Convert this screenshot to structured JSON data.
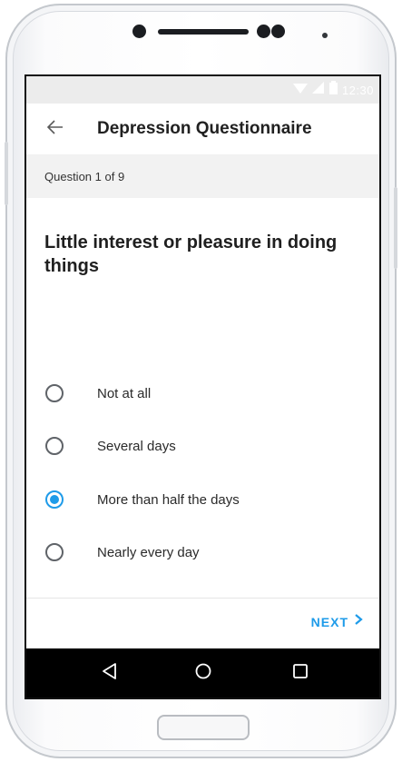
{
  "status_bar": {
    "time": "12:30"
  },
  "app_bar": {
    "title": "Depression Questionnaire",
    "back_icon": "arrow-left-icon"
  },
  "progress": {
    "text": "Question 1 of 9"
  },
  "question": {
    "text": "Little interest or pleasure in doing things"
  },
  "options": [
    {
      "label": "Not at all",
      "selected": false
    },
    {
      "label": "Several days",
      "selected": false
    },
    {
      "label": "More than half the days",
      "selected": true
    },
    {
      "label": "Nearly every day",
      "selected": false
    }
  ],
  "footer": {
    "next_label": "NEXT",
    "next_icon": "chevron-right-icon"
  },
  "nav_bar": {
    "icons": [
      "back-triangle-icon",
      "home-circle-icon",
      "recents-square-icon"
    ]
  },
  "colors": {
    "accent": "#1e9be9",
    "text_primary": "#212121",
    "progress_background": "#f2f2f2",
    "nav_background": "#000000"
  }
}
